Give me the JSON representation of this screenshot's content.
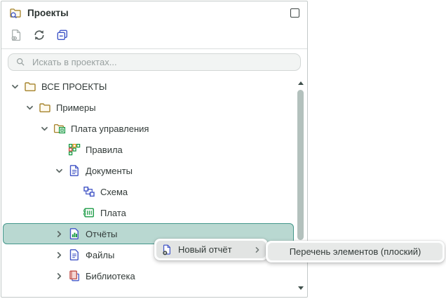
{
  "window": {
    "title": "Проекты"
  },
  "toolbar": {
    "buttons": [
      {
        "name": "preview-report"
      },
      {
        "name": "refresh"
      },
      {
        "name": "collapse-all"
      }
    ]
  },
  "search": {
    "placeholder": "Искать в проектах..."
  },
  "tree": {
    "items": [
      {
        "label": "ВСЕ ПРОЕКТЫ",
        "level": 0,
        "icon": "folder",
        "expander": "expanded",
        "selected": false
      },
      {
        "label": "Примеры",
        "level": 1,
        "icon": "folder",
        "expander": "expanded",
        "selected": false
      },
      {
        "label": "Плата управления",
        "level": 2,
        "icon": "project",
        "expander": "expanded",
        "selected": false
      },
      {
        "label": "Правила",
        "level": 3,
        "icon": "rules",
        "expander": "none",
        "selected": false
      },
      {
        "label": "Документы",
        "level": 3,
        "icon": "documents",
        "expander": "expanded",
        "selected": false
      },
      {
        "label": "Схема",
        "level": 4,
        "icon": "schematic",
        "expander": "none",
        "selected": false
      },
      {
        "label": "Плата",
        "level": 4,
        "icon": "board",
        "expander": "none",
        "selected": false
      },
      {
        "label": "Отчёты",
        "level": 3,
        "icon": "reports",
        "expander": "collapsed",
        "selected": true
      },
      {
        "label": "Файлы",
        "level": 3,
        "icon": "files",
        "expander": "collapsed",
        "selected": false
      },
      {
        "label": "Библиотека",
        "level": 3,
        "icon": "library",
        "expander": "collapsed",
        "selected": false
      }
    ]
  },
  "context_menu": {
    "items": [
      {
        "label": "Новый отчёт",
        "icon": "new-report",
        "has_submenu": true
      }
    ]
  },
  "submenu": {
    "items": [
      {
        "label": "Перечень элементов (плоский)"
      }
    ]
  },
  "colors": {
    "selection_bg": "#b9d8d1",
    "selection_border": "#43968a",
    "accent_blue": "#4356c6",
    "accent_green": "#189a43",
    "folder_outline": "#a5832b",
    "menu_item_bg": "#e2e4e3",
    "panel_border": "#c3c9c8"
  }
}
